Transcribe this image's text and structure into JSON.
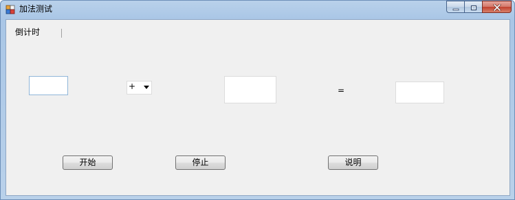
{
  "window": {
    "title": "加法测试"
  },
  "menu": {
    "items": [
      {
        "label": "倒计时"
      }
    ]
  },
  "form": {
    "operand1_value": "",
    "operator": {
      "selected": "+",
      "options": [
        "+"
      ]
    },
    "operand2_value": "",
    "equals_label": "=",
    "result_value": ""
  },
  "buttons": {
    "start_label": "开始",
    "stop_label": "停止",
    "help_label": "说明"
  },
  "icons": {
    "app": "app-icon",
    "minimize": "minimize-icon",
    "maximize": "maximize-icon",
    "close": "close-icon",
    "dropdown": "chevron-down-icon"
  },
  "colors": {
    "titlebar": "#b9d1ea",
    "client_bg": "#f0f0f0",
    "close_button": "#c0402f",
    "focused_input_border": "#8fb5d8"
  }
}
